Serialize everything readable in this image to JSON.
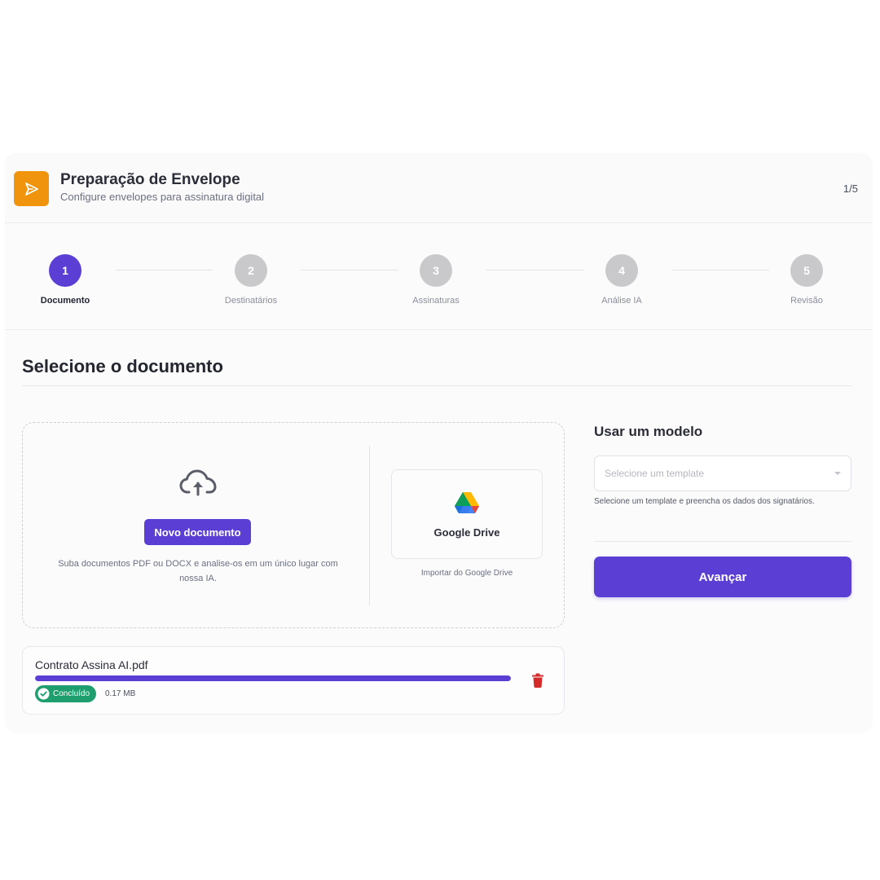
{
  "header": {
    "title": "Preparação de Envelope",
    "subtitle": "Configure envelopes para assinatura digital",
    "page_counter": "1/5",
    "logo_icon": "send-arrow-icon",
    "logo_color": "#f0940d"
  },
  "stepper": {
    "steps": [
      {
        "number": "1",
        "label": "Documento",
        "active": true
      },
      {
        "number": "2",
        "label": "Destinatários",
        "active": false
      },
      {
        "number": "3",
        "label": "Assinaturas",
        "active": false
      },
      {
        "number": "4",
        "label": "Análise IA",
        "active": false
      },
      {
        "number": "5",
        "label": "Revisão",
        "active": false
      }
    ]
  },
  "main": {
    "section_title": "Selecione o documento",
    "upload": {
      "icon": "cloud-upload-icon",
      "button_label": "Novo documento",
      "help_text": "Suba documentos PDF ou DOCX e analise-os em um único lugar com nossa IA."
    },
    "gdrive": {
      "label": "Google Drive",
      "help_text": "Importar do Google Drive"
    },
    "file": {
      "name": "Contrato Assina AI.pdf",
      "progress_percent": 100,
      "status": "Concluído",
      "size": "0.17 MB",
      "status_color": "#1e9e6e"
    }
  },
  "template": {
    "title": "Usar um modelo",
    "placeholder": "Selecione um template",
    "help_text": "Selecione um template e preencha os dados dos signatários.",
    "advance_label": "Avançar"
  },
  "colors": {
    "accent": "#5b3fd4",
    "danger": "#d42a2a"
  }
}
